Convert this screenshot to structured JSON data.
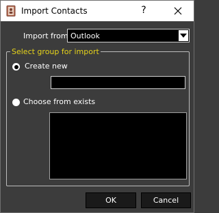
{
  "window": {
    "title": "Import Contacts",
    "help_label": "?"
  },
  "import_from": {
    "label": "Import from:",
    "selected": "Outlook"
  },
  "group": {
    "title": "Select group for import",
    "create_new_label": "Create new",
    "choose_label": "Choose from exists",
    "selected_option": "Create new"
  },
  "buttons": {
    "ok": "OK",
    "cancel": "Cancel"
  },
  "colors": {
    "group_title": "#e6d31a",
    "dialog_bg": "#3c3c3c"
  }
}
